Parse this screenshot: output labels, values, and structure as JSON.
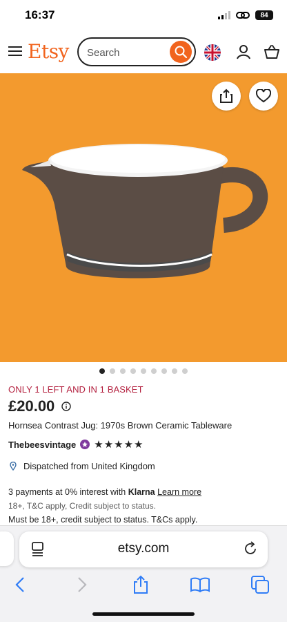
{
  "status_bar": {
    "time": "16:37",
    "battery": "84"
  },
  "header": {
    "logo": "Etsy",
    "search_placeholder": "Search",
    "icons": [
      "menu-icon",
      "search-icon",
      "uk-flag-icon",
      "user-icon",
      "basket-icon"
    ],
    "brand_color": "#f1641e"
  },
  "product": {
    "image_background": "#f39a2e",
    "carousel": {
      "count": 9,
      "active_index": 0
    },
    "stock_message": "ONLY 1 LEFT AND IN 1 BASKET",
    "price": "£20.00",
    "title": "Hornsea Contrast Jug: 1970s Brown Ceramic Tableware",
    "seller": "Thebeesvintage",
    "rating_stars": "★★★★★",
    "dispatch": "Dispatched from United Kingdom"
  },
  "klarna": {
    "prefix": "3 payments at 0% interest with",
    "brand": "Klarna",
    "learn_more": "Learn more",
    "note": "18+, T&C apply, Credit subject to status.",
    "credit_note": "Must be 18+, credit subject to status. T&Cs apply."
  },
  "safari": {
    "url": "etsy.com",
    "toolbar_icons": [
      "back-icon",
      "forward-icon",
      "share-icon",
      "bookmarks-icon",
      "tabs-icon"
    ]
  }
}
